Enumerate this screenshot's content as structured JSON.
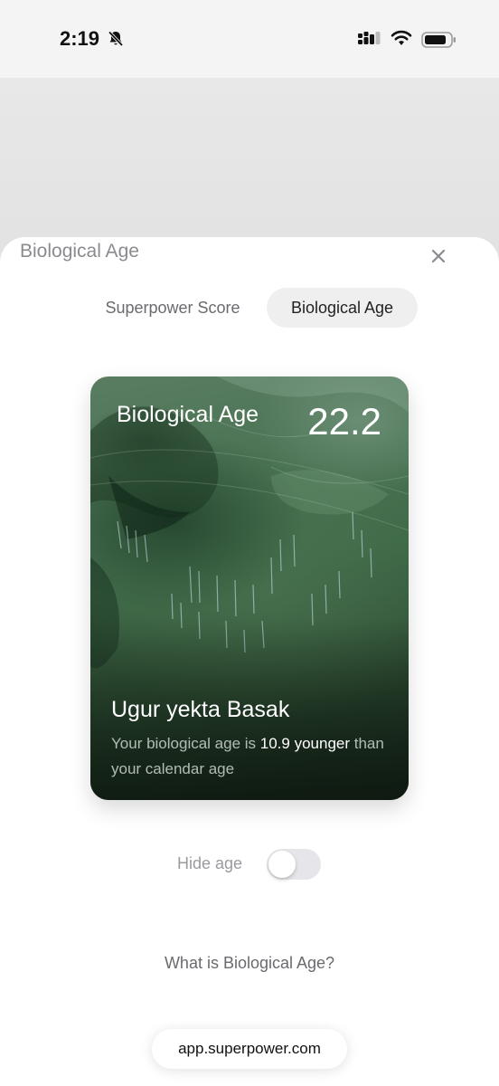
{
  "status_bar": {
    "time": "2:19",
    "icons": [
      "bell-slash-icon",
      "signal-icon",
      "wifi-icon",
      "battery-icon"
    ]
  },
  "sheet": {
    "title": "Biological Age",
    "close_icon": "close-icon"
  },
  "tabs": [
    {
      "label": "Superpower Score",
      "active": false
    },
    {
      "label": "Biological Age",
      "active": true
    }
  ],
  "card": {
    "label": "Biological Age",
    "value": "22.2",
    "name": "Ugur yekta Basak",
    "desc_prefix": "Your biological age is ",
    "desc_highlight": "10.9 younger",
    "desc_suffix": " than your calendar age"
  },
  "hide_age": {
    "label": "Hide age",
    "enabled": false
  },
  "info_link": "What is Biological Age?",
  "browser": {
    "url": "app.superpower.com"
  },
  "colors": {
    "card_green": "#3f6a48",
    "tab_active_bg": "#efeff0",
    "muted_text": "#8a8a8f"
  }
}
